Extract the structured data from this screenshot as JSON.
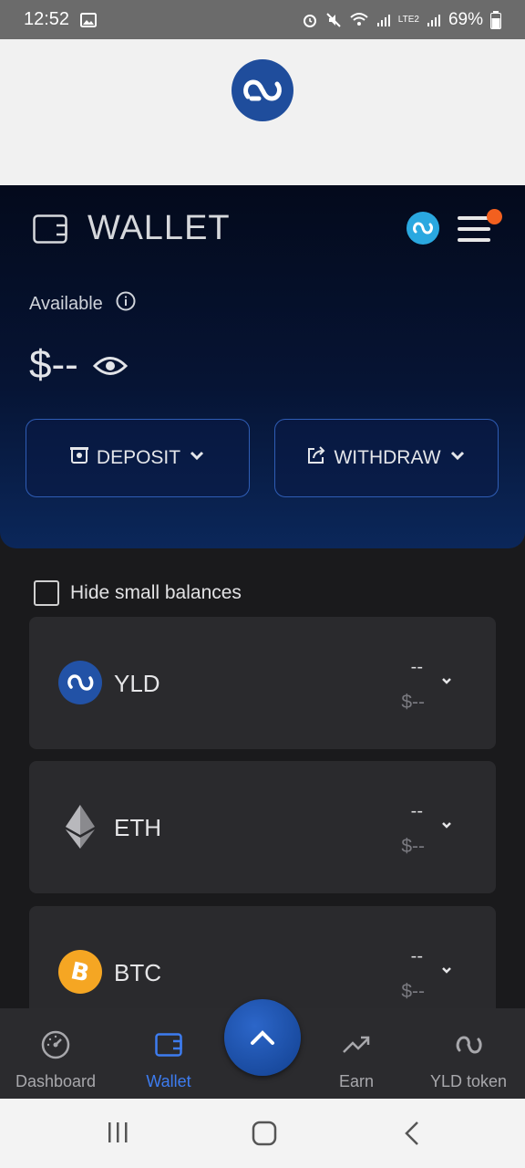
{
  "status_bar": {
    "time": "12:52",
    "battery": "69%",
    "network_label": "LTE2"
  },
  "hero": {
    "title": "WALLET",
    "available_label": "Available",
    "balance": "$--",
    "deposit_label": "DEPOSIT",
    "withdraw_label": "WITHDRAW"
  },
  "list": {
    "hide_small_label": "Hide small balances",
    "assets": [
      {
        "symbol": "YLD",
        "amount": "--",
        "usd": "$--",
        "icon": "yld-icon"
      },
      {
        "symbol": "ETH",
        "amount": "--",
        "usd": "$--",
        "icon": "eth-icon"
      },
      {
        "symbol": "BTC",
        "amount": "--",
        "usd": "$--",
        "icon": "btc-icon"
      }
    ]
  },
  "bottom_nav": {
    "items": [
      {
        "label": "Dashboard",
        "icon": "gauge-icon"
      },
      {
        "label": "Wallet",
        "icon": "wallet-icon",
        "active": true
      },
      {
        "label": "Earn",
        "icon": "trend-up-icon"
      },
      {
        "label": "YLD token",
        "icon": "yld-token-icon"
      }
    ]
  },
  "colors": {
    "accent": "#3d7cf0",
    "brand": "#1f4d9c",
    "notification": "#f2601f",
    "btc": "#f5a623",
    "yld_badge": "#2aa8e0"
  }
}
